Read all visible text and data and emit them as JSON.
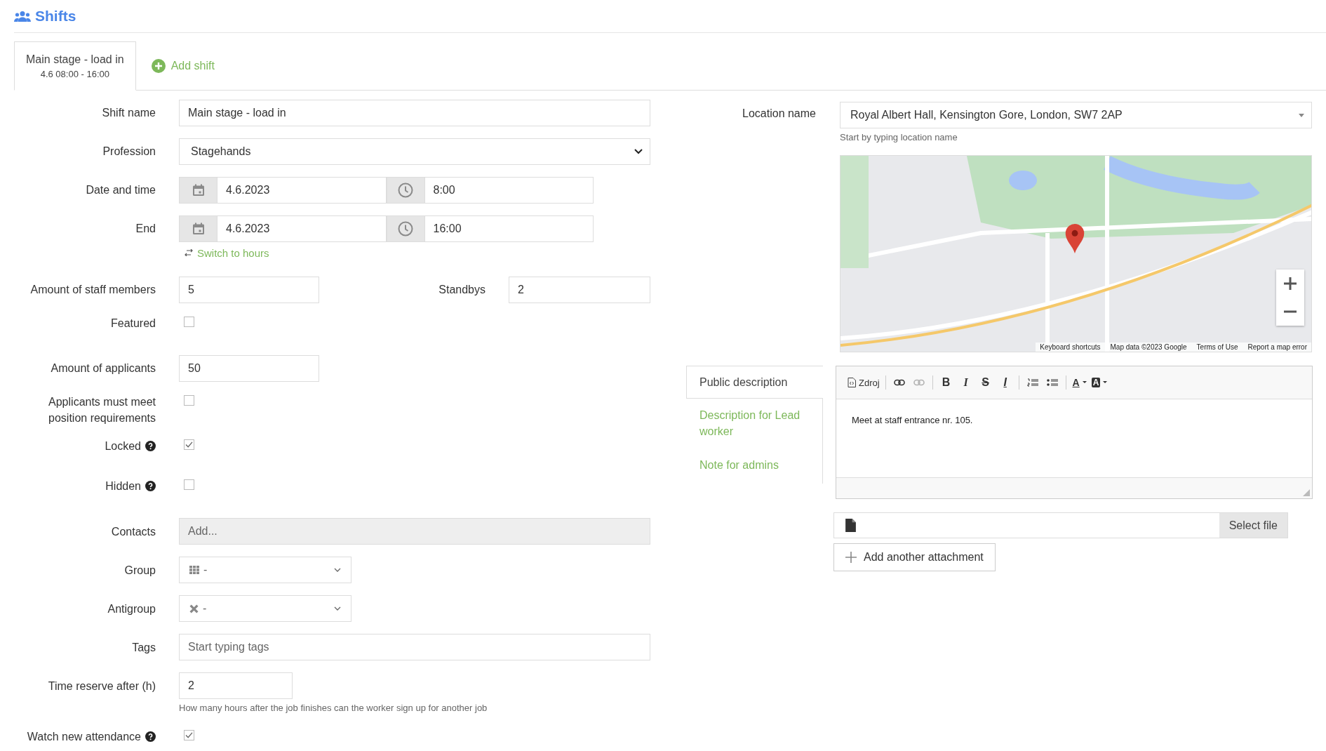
{
  "header": {
    "title": "Shifts"
  },
  "shift_tabs": [
    {
      "label": "Main stage - load in",
      "sublabel": "4.6 08:00 - 16:00",
      "selected": true
    }
  ],
  "add_shift": "Add shift",
  "fields": [
    {
      "kind": "text",
      "label": "Shift name",
      "value": "Main stage - load in"
    },
    {
      "kind": "select",
      "label": "Profession",
      "value": "Stagehands"
    },
    {
      "kind": "datetime",
      "label": "Date and time",
      "date": "4.6.2023",
      "time": "8:00"
    },
    {
      "kind": "datetime",
      "label": "End",
      "date": "4.6.2023",
      "time": "16:00"
    },
    {
      "kind": "link",
      "label": "Switch to hours"
    },
    {
      "kind": "pair",
      "label": "Amount of staff members",
      "value": "5",
      "label2": "Standbys",
      "value2": "2"
    },
    {
      "kind": "checkbox",
      "label": "Featured",
      "checked": false,
      "help": false
    },
    {
      "kind": "short",
      "label": "Amount of applicants",
      "value": "50"
    },
    {
      "kind": "checkbox",
      "label": "Applicants must meet position requirements",
      "checked": false,
      "help": false
    },
    {
      "kind": "checkbox",
      "label": "Locked",
      "checked": true,
      "help": true
    },
    {
      "kind": "checkbox",
      "label": "Hidden",
      "checked": false,
      "help": true
    },
    {
      "kind": "contacts",
      "label": "Contacts",
      "placeholder": "Add..."
    },
    {
      "kind": "group",
      "label": "Group",
      "value": "-"
    },
    {
      "kind": "antigroup",
      "label": "Antigroup",
      "value": "-"
    },
    {
      "kind": "text",
      "label": "Tags",
      "placeholder": "Start typing tags"
    },
    {
      "kind": "reserve",
      "label": "Time reserve after (h)",
      "value": "2",
      "hint": "How many hours after the job finishes can the worker sign up for another job"
    },
    {
      "kind": "checkbox",
      "label": "Watch new attendance",
      "checked": true,
      "help": true
    }
  ],
  "location": {
    "label": "Location name",
    "value": "Royal Albert Hall, Kensington Gore, London, SW7 2AP",
    "hint": "Start by typing location name"
  },
  "map": {
    "attribution": [
      "Keyboard shortcuts",
      "Map data ©2023 Google",
      "Terms of Use",
      "Report a map error"
    ]
  },
  "description": {
    "tabs": [
      {
        "label": "Public description",
        "selected": true
      },
      {
        "label": "Description for Lead worker",
        "selected": false
      },
      {
        "label": "Note for admins",
        "selected": false
      }
    ],
    "toolbar": [
      {
        "kind": "source",
        "label": "Zdroj"
      },
      {
        "kind": "separator"
      },
      {
        "kind": "link"
      },
      {
        "kind": "unlink",
        "disabled": true
      },
      {
        "kind": "separator"
      },
      {
        "kind": "bold",
        "glyph": "B"
      },
      {
        "kind": "italic",
        "glyph": "I"
      },
      {
        "kind": "strike",
        "glyph": "S"
      },
      {
        "kind": "clear",
        "glyph": "I"
      },
      {
        "kind": "separator"
      },
      {
        "kind": "ol"
      },
      {
        "kind": "ul"
      },
      {
        "kind": "separator"
      },
      {
        "kind": "color",
        "glyph": "A"
      },
      {
        "kind": "bgcolor",
        "glyph": "A"
      }
    ],
    "content": "Meet at staff entrance nr. 105."
  },
  "attachment": {
    "button": "Select file",
    "add": "Add another attachment"
  }
}
